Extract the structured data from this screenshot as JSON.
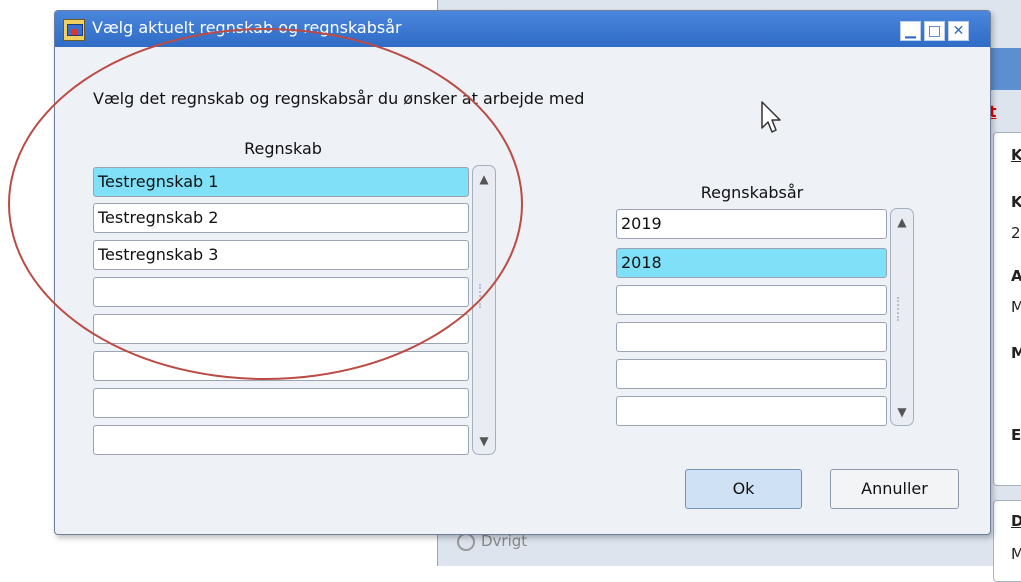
{
  "background": {
    "red_link_fragment": "et",
    "letters": [
      "K",
      "K",
      "2",
      "A",
      "M",
      "M",
      "E",
      "D",
      "M"
    ],
    "link_text": "Dvrigt"
  },
  "dialog": {
    "title": "Vælg aktuelt regnskab og regnskabsår",
    "instruction": "Vælg det regnskab og regnskabsår du ønsker at arbejde med",
    "regnskab": {
      "header": "Regnskab",
      "items": [
        "Testregnskab 1",
        "Testregnskab 2",
        "Testregnskab 3",
        "",
        "",
        "",
        "",
        ""
      ],
      "selected_index": 0
    },
    "regnskabsaar": {
      "header": "Regnskabsår",
      "items": [
        "2019",
        "2018",
        "",
        "",
        "",
        ""
      ],
      "selected_index": 1
    },
    "buttons": {
      "ok": "Ok",
      "cancel": "Annuller"
    }
  },
  "icons": {
    "minimize": "minimize-icon",
    "maximize": "maximize-icon",
    "close": "close-icon",
    "scroll_up": "chevron-up-icon",
    "scroll_down": "chevron-down-icon"
  }
}
